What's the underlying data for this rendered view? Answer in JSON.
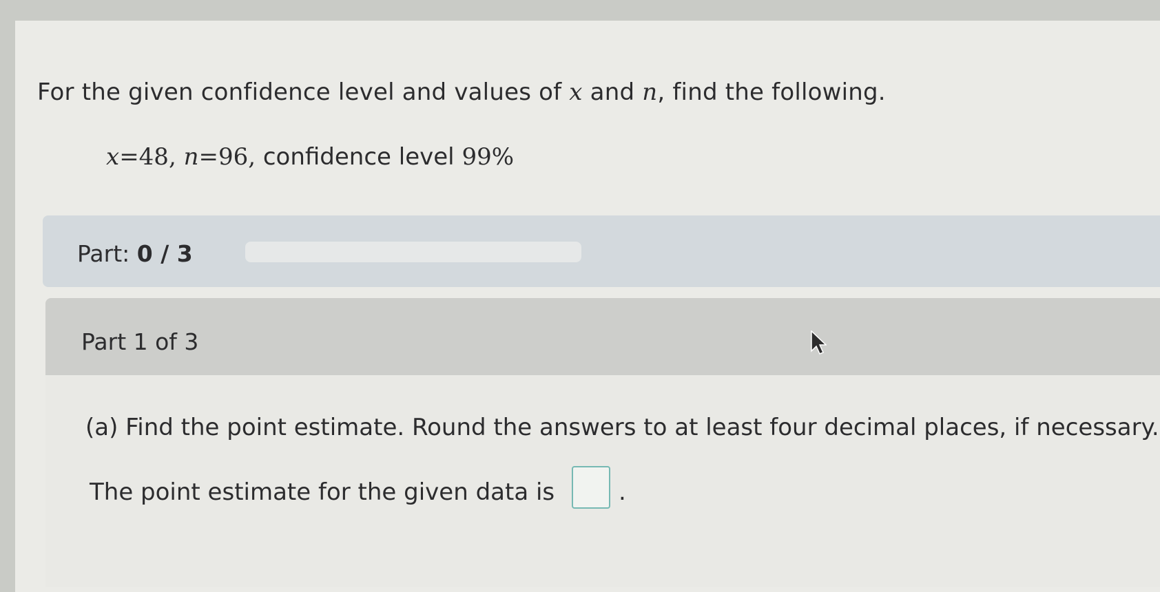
{
  "prompt": {
    "before_x": "For the given confidence level and values of ",
    "x_symbol": "x",
    "and_text": " and ",
    "n_symbol": "n",
    "after_n": ", find the following."
  },
  "given": {
    "x_symbol": "x",
    "x_equals": "=48, ",
    "n_symbol": "n",
    "n_equals": "=96, ",
    "confidence_text": "confidence level ",
    "confidence_value": "99%"
  },
  "progress": {
    "label": "Part: ",
    "value_text": "0 / 3",
    "completed": 0,
    "total": 3
  },
  "part": {
    "header": "Part 1 of 3",
    "question": "(a) Find the point estimate. Round the answers to at least four decimal places, if necessary.",
    "answer_prefix": "The point estimate for the given data is",
    "answer_value": "",
    "answer_suffix": "."
  },
  "colors": {
    "progress_fill": "#4b83c2",
    "input_border": "#76b9b3"
  }
}
